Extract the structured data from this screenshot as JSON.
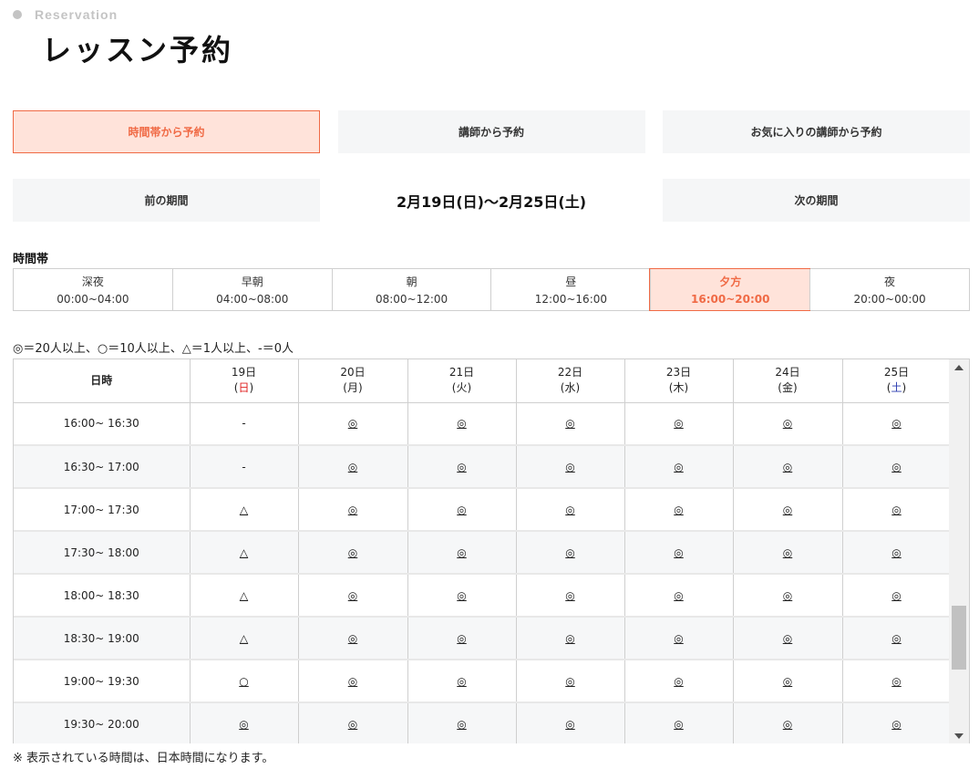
{
  "header": {
    "eyebrow": "Reservation",
    "title": "レッスン予約"
  },
  "mode_tabs": [
    {
      "label": "時間帯から予約",
      "active": true
    },
    {
      "label": "講師から予約",
      "active": false
    },
    {
      "label": "お気に入りの講師から予約",
      "active": false
    }
  ],
  "period": {
    "prev_label": "前の期間",
    "range": "2月19日(日)〜2月25日(土)",
    "next_label": "次の期間"
  },
  "timezone": {
    "label": "時間帯",
    "slots": [
      {
        "name": "深夜",
        "range": "00:00~04:00",
        "active": false
      },
      {
        "name": "早朝",
        "range": "04:00~08:00",
        "active": false
      },
      {
        "name": "朝",
        "range": "08:00~12:00",
        "active": false
      },
      {
        "name": "昼",
        "range": "12:00~16:00",
        "active": false
      },
      {
        "name": "夕方",
        "range": "16:00~20:00",
        "active": true
      },
      {
        "name": "夜",
        "range": "20:00~00:00",
        "active": false
      }
    ]
  },
  "legend": "◎＝20人以上、○＝10人以上、△＝1人以上、-＝0人",
  "schedule": {
    "corner_label": "日時",
    "days": [
      {
        "date": "19日",
        "weekday": "日",
        "type": "sun"
      },
      {
        "date": "20日",
        "weekday": "月",
        "type": "weekday"
      },
      {
        "date": "21日",
        "weekday": "火",
        "type": "weekday"
      },
      {
        "date": "22日",
        "weekday": "水",
        "type": "weekday"
      },
      {
        "date": "23日",
        "weekday": "木",
        "type": "weekday"
      },
      {
        "date": "24日",
        "weekday": "金",
        "type": "weekday"
      },
      {
        "date": "25日",
        "weekday": "土",
        "type": "sat"
      }
    ],
    "rows": [
      {
        "time": "16:00~ 16:30",
        "cells": [
          "-",
          "◎",
          "◎",
          "◎",
          "◎",
          "◎",
          "◎"
        ]
      },
      {
        "time": "16:30~ 17:00",
        "cells": [
          "-",
          "◎",
          "◎",
          "◎",
          "◎",
          "◎",
          "◎"
        ]
      },
      {
        "time": "17:00~ 17:30",
        "cells": [
          "△",
          "◎",
          "◎",
          "◎",
          "◎",
          "◎",
          "◎"
        ]
      },
      {
        "time": "17:30~ 18:00",
        "cells": [
          "△",
          "◎",
          "◎",
          "◎",
          "◎",
          "◎",
          "◎"
        ]
      },
      {
        "time": "18:00~ 18:30",
        "cells": [
          "△",
          "◎",
          "◎",
          "◎",
          "◎",
          "◎",
          "◎"
        ]
      },
      {
        "time": "18:30~ 19:00",
        "cells": [
          "△",
          "◎",
          "◎",
          "◎",
          "◎",
          "◎",
          "◎"
        ]
      },
      {
        "time": "19:00~ 19:30",
        "cells": [
          "○",
          "◎",
          "◎",
          "◎",
          "◎",
          "◎",
          "◎"
        ]
      },
      {
        "time": "19:30~ 20:00",
        "cells": [
          "◎",
          "◎",
          "◎",
          "◎",
          "◎",
          "◎",
          "◎"
        ]
      }
    ]
  },
  "note": "※ 表示されている時間は、日本時間になります。",
  "colors": {
    "accent": "#f06a45",
    "accent_bg": "#ffe3da",
    "button_bg": "#f5f6f7",
    "sunday": "#e02020",
    "saturday": "#2a3bb0"
  }
}
